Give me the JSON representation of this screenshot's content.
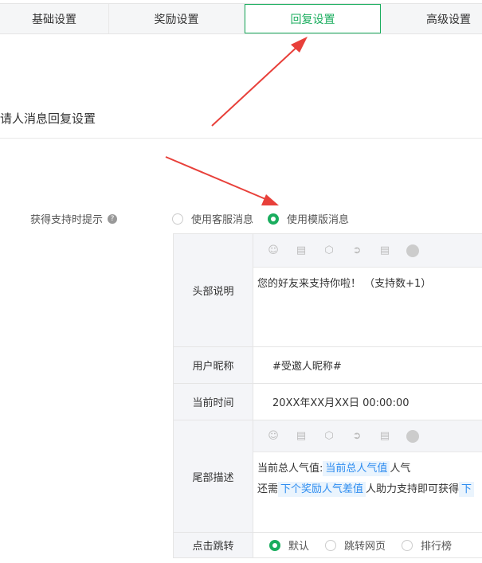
{
  "tabs": [
    {
      "label": "基础设置"
    },
    {
      "label": "奖励设置"
    },
    {
      "label": "回复设置"
    },
    {
      "label": "高级设置"
    }
  ],
  "active_tab": "回复设置",
  "section_title": "请人消息回复设置",
  "support_prompt": {
    "label": "获得支持时提示",
    "help": "?",
    "options": [
      {
        "label": "使用客服消息",
        "selected": false
      },
      {
        "label": "使用模版消息",
        "selected": true
      }
    ]
  },
  "template": {
    "header": {
      "label": "头部说明",
      "text": "您的好友来支持你啦！ （支持数+1）"
    },
    "nickname": {
      "label": "用户昵称",
      "value": "#受邀人昵称#"
    },
    "time": {
      "label": "当前时间",
      "value": "20XX年XX月XX日 00:00:00"
    },
    "footer": {
      "label": "尾部描述",
      "line1_prefix": "当前总人气值:",
      "line1_chip": "当前总人气值",
      "line1_suffix": "人气",
      "line2_prefix": "还需",
      "line2_chip": "下个奖励人气差值",
      "line2_suffix": "人助力支持即可获得",
      "line2_chip2": "下"
    },
    "jump": {
      "label": "点击跳转",
      "options": [
        {
          "label": "默认",
          "selected": true
        },
        {
          "label": "跳转网页",
          "selected": false
        },
        {
          "label": "排行榜",
          "selected": false
        }
      ]
    }
  },
  "colors": {
    "accent": "#1aad5e",
    "arrow": "#e8403a",
    "chip": "#2d8cf0"
  }
}
